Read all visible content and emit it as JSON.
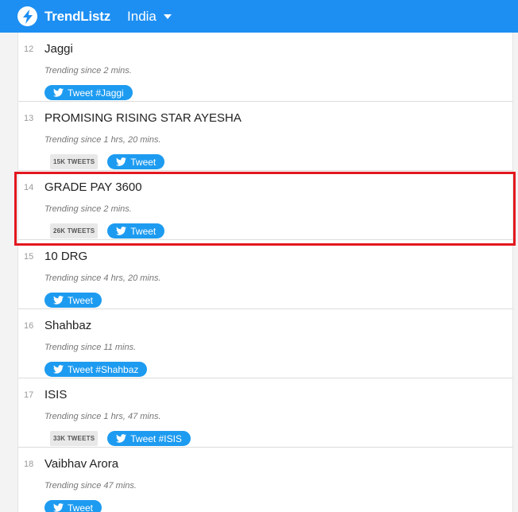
{
  "header": {
    "brand": "TrendListz",
    "country": "India"
  },
  "trends": [
    {
      "rank": "12",
      "name": "Jaggi",
      "since": "Trending since 2 mins.",
      "tweets": "",
      "button": "Tweet #Jaggi"
    },
    {
      "rank": "13",
      "name": "PROMISING RISING STAR AYESHA",
      "since": "Trending since 1 hrs, 20 mins.",
      "tweets": "15K TWEETS",
      "button": "Tweet"
    },
    {
      "rank": "14",
      "name": "GRADE PAY 3600",
      "since": "Trending since 2 mins.",
      "tweets": "26K TWEETS",
      "button": "Tweet"
    },
    {
      "rank": "15",
      "name": "10 DRG",
      "since": "Trending since 4 hrs, 20 mins.",
      "tweets": "",
      "button": "Tweet"
    },
    {
      "rank": "16",
      "name": "Shahbaz",
      "since": "Trending since 11 mins.",
      "tweets": "",
      "button": "Tweet #Shahbaz"
    },
    {
      "rank": "17",
      "name": "ISIS",
      "since": "Trending since 1 hrs, 47 mins.",
      "tweets": "33K TWEETS",
      "button": "Tweet #ISIS"
    },
    {
      "rank": "18",
      "name": "Vaibhav Arora",
      "since": "Trending since 47 mins.",
      "tweets": "",
      "button": "Tweet"
    }
  ],
  "colors": {
    "navbar": "#1d8ff2",
    "tweet_button": "#1d9bf0",
    "highlight": "#e3171f"
  },
  "icons": {
    "logo": "lightning-bolt-icon",
    "tweet": "twitter-bird-icon",
    "dropdown": "caret-down-icon"
  }
}
